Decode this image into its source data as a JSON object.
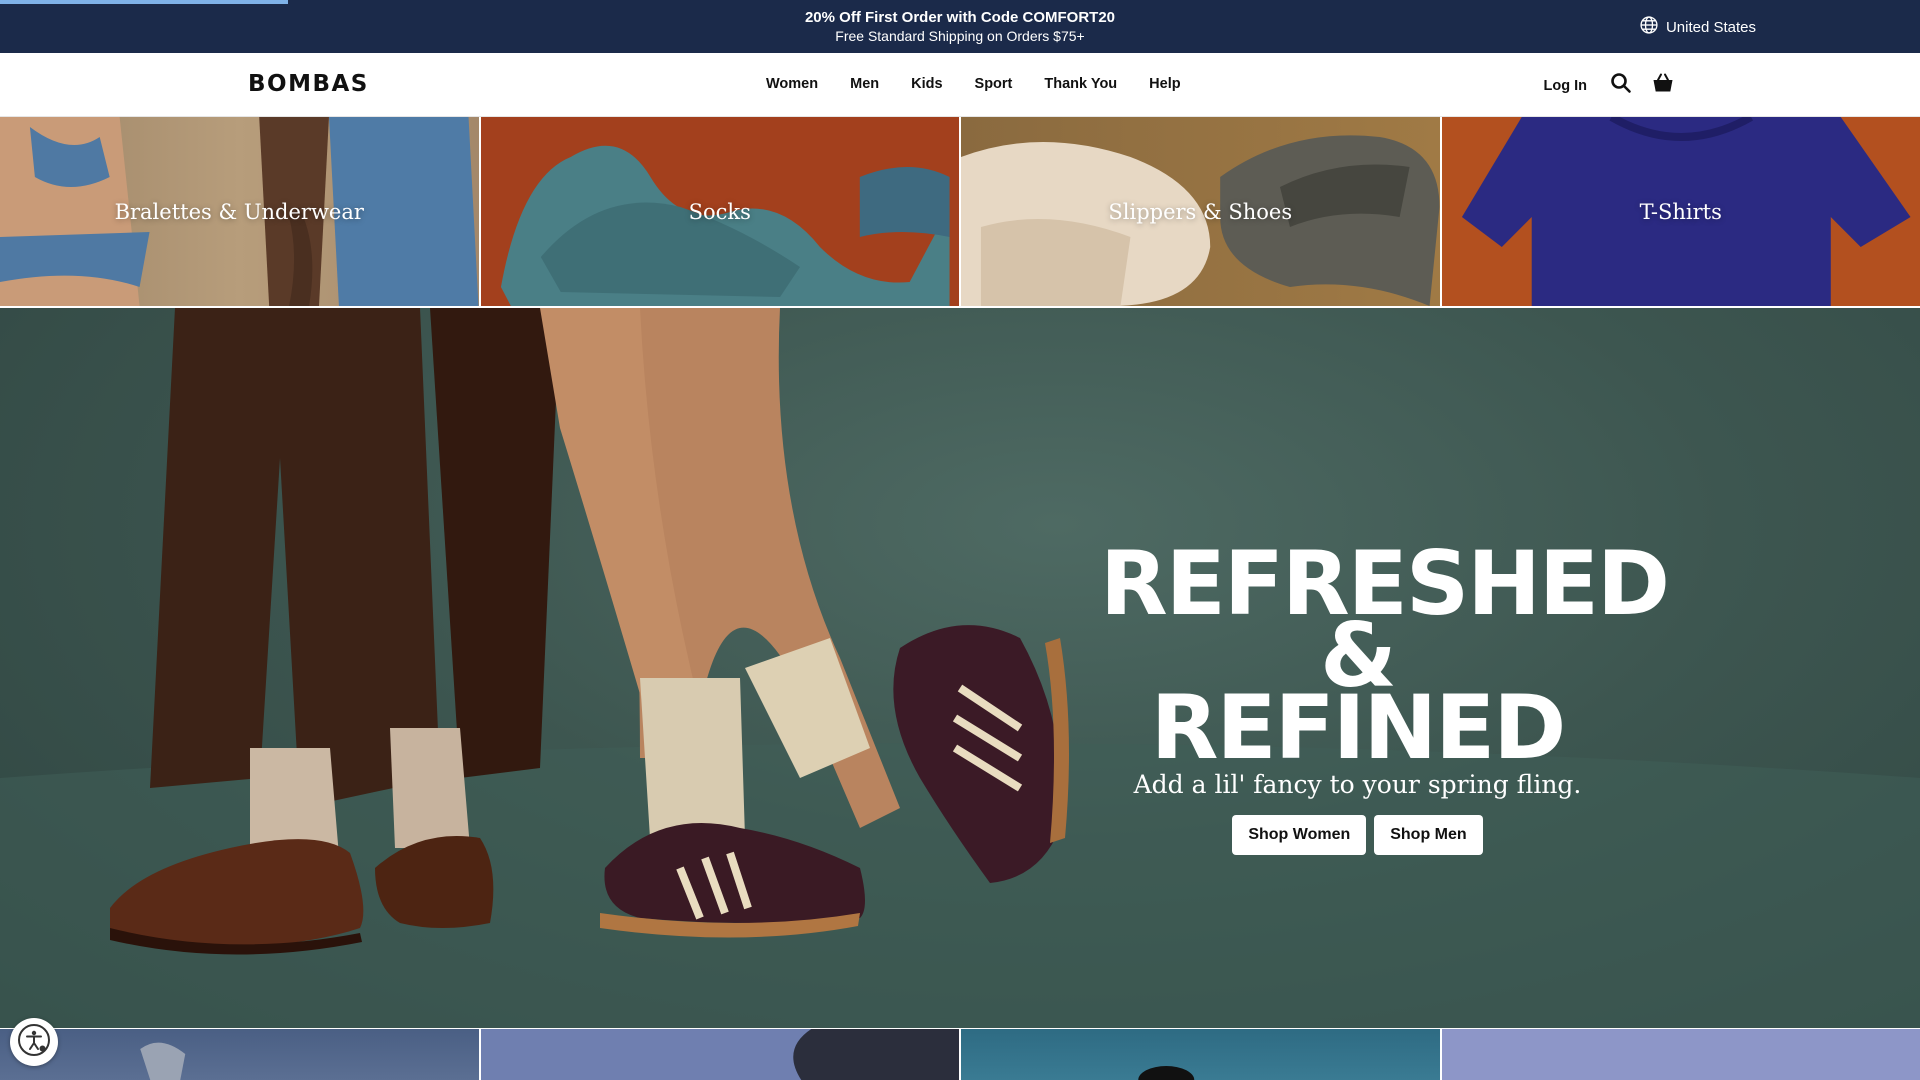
{
  "announcement": {
    "line1": "20% Off First Order with Code COMFORT20",
    "line2": "Free Standard Shipping on Orders $75+",
    "region": "United States",
    "progress_fraction": 0.15
  },
  "nav": {
    "logo": "BOMBAS",
    "menu": [
      "Women",
      "Men",
      "Kids",
      "Sport",
      "Thank You",
      "Help"
    ],
    "login": "Log In"
  },
  "tiles": [
    {
      "label": "Bralettes & Underwear"
    },
    {
      "label": "Socks"
    },
    {
      "label": "Slippers & Shoes"
    },
    {
      "label": "T-Shirts"
    }
  ],
  "hero": {
    "headline_line1": "REFRESHED",
    "headline_line2": "& REFINED",
    "subhead": "Add a lil' fancy to your spring fling.",
    "cta_women": "Shop Women",
    "cta_men": "Shop Men"
  },
  "colors": {
    "announcement_bg": "#1b2a4a",
    "hero_bg": "#3d5650",
    "button_bg": "#ffffff"
  }
}
